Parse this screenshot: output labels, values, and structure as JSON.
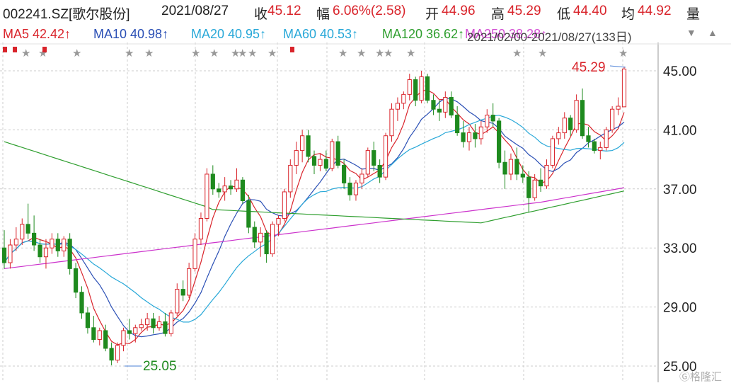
{
  "header": {
    "code": "002241.SZ[歌尔股份]",
    "date": "2021/08/27",
    "close_label": "收",
    "close_value": "45.12",
    "change_label": "幅",
    "change_value": "6.06%(2.58)",
    "open_label": "开",
    "open_value": "44.96",
    "high_label": "高",
    "high_value": "45.29",
    "low_label": "低",
    "low_value": "44.40",
    "avg_label": "均",
    "avg_value": "44.92",
    "volume_label": "量"
  },
  "ma_bar": {
    "ma5": "MA5  42.42↑",
    "ma10": "MA10  40.98↑",
    "ma20": "MA20  40.95↑",
    "ma60": "MA60  40.53↑",
    "ma120": "MA120  36.62↑",
    "ma250": "MA250  38.28↑",
    "range": "2021/02/00-2021/08/27(133日)",
    "dropdown": "▼"
  },
  "colors": {
    "up": "#d9242b",
    "down": "#1e8a1e",
    "ma5": "#d9242b",
    "ma10": "#2a4fb5",
    "ma20": "#28a8d8",
    "ma60": "#cc33cc",
    "ma120": "#2e9e2e",
    "ma250": "#cc33cc",
    "grid": "#cccccc"
  },
  "chart_data": {
    "type": "candlestick",
    "ylim": [
      25,
      46.2
    ],
    "yticks": [
      "45.00",
      "41.00",
      "37.00",
      "33.00",
      "29.00",
      "25.00"
    ],
    "ytick_values": [
      45,
      41,
      37,
      33,
      29,
      25
    ],
    "annotations": {
      "high": "45.29",
      "low": "25.05"
    },
    "grid": true,
    "candles": [
      [
        33.0,
        34.2,
        31.6,
        32.0
      ],
      [
        32.0,
        33.6,
        31.6,
        33.2
      ],
      [
        33.2,
        34.4,
        32.8,
        33.6
      ],
      [
        33.6,
        35.0,
        33.2,
        34.6
      ],
      [
        34.6,
        36.0,
        33.6,
        34.0
      ],
      [
        34.0,
        35.2,
        32.8,
        33.2
      ],
      [
        33.2,
        33.6,
        32.0,
        32.4
      ],
      [
        32.4,
        33.6,
        31.6,
        33.0
      ],
      [
        33.0,
        34.0,
        32.6,
        33.6
      ],
      [
        33.6,
        34.0,
        32.4,
        32.8
      ],
      [
        32.8,
        33.8,
        32.4,
        33.6
      ],
      [
        33.6,
        34.0,
        31.2,
        31.6
      ],
      [
        31.6,
        32.0,
        29.6,
        30.0
      ],
      [
        30.0,
        30.4,
        28.2,
        28.6
      ],
      [
        28.6,
        29.0,
        27.2,
        27.6
      ],
      [
        27.6,
        28.4,
        26.6,
        26.8
      ],
      [
        26.8,
        27.6,
        26.4,
        27.4
      ],
      [
        27.4,
        27.8,
        26.0,
        26.2
      ],
      [
        26.2,
        26.6,
        25.05,
        25.4
      ],
      [
        25.4,
        26.6,
        25.2,
        26.4
      ],
      [
        26.4,
        27.6,
        26.0,
        27.4
      ],
      [
        27.4,
        28.2,
        26.8,
        27.2
      ],
      [
        27.2,
        27.8,
        26.6,
        27.6
      ],
      [
        27.6,
        28.2,
        27.4,
        27.8
      ],
      [
        27.8,
        28.6,
        27.4,
        28.2
      ],
      [
        28.2,
        28.6,
        27.2,
        27.6
      ],
      [
        27.6,
        28.4,
        27.4,
        28.0
      ],
      [
        28.0,
        28.6,
        27.0,
        27.2
      ],
      [
        27.2,
        28.8,
        27.0,
        28.6
      ],
      [
        28.6,
        30.6,
        28.4,
        30.2
      ],
      [
        30.2,
        30.8,
        29.4,
        29.8
      ],
      [
        29.8,
        32.0,
        29.6,
        31.6
      ],
      [
        31.6,
        34.0,
        31.4,
        33.6
      ],
      [
        33.6,
        35.4,
        33.2,
        35.0
      ],
      [
        35.0,
        38.4,
        34.8,
        38.0
      ],
      [
        38.0,
        38.6,
        36.6,
        37.0
      ],
      [
        37.0,
        37.4,
        36.4,
        36.8
      ],
      [
        36.8,
        37.8,
        36.2,
        37.2
      ],
      [
        37.2,
        37.6,
        36.6,
        37.0
      ],
      [
        37.0,
        38.4,
        36.8,
        37.6
      ],
      [
        37.6,
        37.8,
        36.0,
        36.2
      ],
      [
        36.2,
        36.6,
        34.0,
        34.4
      ],
      [
        34.4,
        34.8,
        33.0,
        33.4
      ],
      [
        33.4,
        34.4,
        32.4,
        34.0
      ],
      [
        34.0,
        34.2,
        32.0,
        32.6
      ],
      [
        32.6,
        34.8,
        32.4,
        34.6
      ],
      [
        34.6,
        35.2,
        33.8,
        35.0
      ],
      [
        35.0,
        37.0,
        34.8,
        36.8
      ],
      [
        36.8,
        39.0,
        36.4,
        38.6
      ],
      [
        38.6,
        40.2,
        38.0,
        39.6
      ],
      [
        39.6,
        41.0,
        38.8,
        40.6
      ],
      [
        40.6,
        41.0,
        38.8,
        39.2
      ],
      [
        39.2,
        39.6,
        38.0,
        38.6
      ],
      [
        38.6,
        39.4,
        38.2,
        39.0
      ],
      [
        39.0,
        39.6,
        38.2,
        38.4
      ],
      [
        38.4,
        40.4,
        38.2,
        40.2
      ],
      [
        40.2,
        40.6,
        38.4,
        38.6
      ],
      [
        38.6,
        39.0,
        37.0,
        37.4
      ],
      [
        37.4,
        37.8,
        36.2,
        36.6
      ],
      [
        36.6,
        37.6,
        36.2,
        37.4
      ],
      [
        37.4,
        38.4,
        37.0,
        38.0
      ],
      [
        38.0,
        39.8,
        37.8,
        39.6
      ],
      [
        39.6,
        40.2,
        38.2,
        38.6
      ],
      [
        38.6,
        39.0,
        37.4,
        37.8
      ],
      [
        37.8,
        40.8,
        37.6,
        40.6
      ],
      [
        40.6,
        42.8,
        40.2,
        42.4
      ],
      [
        42.4,
        43.2,
        41.6,
        42.8
      ],
      [
        42.8,
        43.6,
        42.4,
        43.4
      ],
      [
        43.4,
        44.8,
        43.0,
        44.4
      ],
      [
        44.4,
        44.6,
        42.6,
        43.0
      ],
      [
        43.0,
        45.0,
        42.8,
        44.6
      ],
      [
        44.6,
        44.8,
        42.8,
        43.0
      ],
      [
        43.0,
        43.4,
        42.0,
        42.4
      ],
      [
        42.4,
        43.0,
        41.6,
        42.2
      ],
      [
        42.2,
        43.6,
        41.8,
        43.2
      ],
      [
        43.2,
        43.6,
        41.8,
        42.0
      ],
      [
        42.0,
        42.6,
        40.6,
        40.8
      ],
      [
        40.8,
        41.6,
        39.8,
        40.2
      ],
      [
        40.2,
        41.2,
        39.6,
        40.8
      ],
      [
        40.8,
        41.4,
        39.8,
        40.4
      ],
      [
        40.4,
        41.6,
        40.0,
        41.2
      ],
      [
        41.2,
        42.4,
        40.8,
        42.0
      ],
      [
        42.0,
        42.8,
        41.2,
        41.6
      ],
      [
        41.6,
        41.8,
        38.4,
        38.8
      ],
      [
        38.8,
        39.6,
        37.0,
        38.0
      ],
      [
        38.0,
        39.4,
        37.6,
        39.0
      ],
      [
        39.0,
        39.8,
        37.6,
        38.0
      ],
      [
        38.0,
        38.6,
        37.4,
        37.8
      ],
      [
        37.8,
        38.2,
        35.4,
        36.4
      ],
      [
        36.4,
        38.0,
        36.2,
        37.6
      ],
      [
        37.6,
        38.4,
        36.8,
        37.2
      ],
      [
        37.2,
        39.0,
        37.0,
        38.6
      ],
      [
        38.6,
        40.6,
        38.4,
        40.4
      ],
      [
        40.4,
        41.2,
        40.0,
        40.8
      ],
      [
        40.8,
        42.2,
        40.4,
        41.8
      ],
      [
        41.8,
        42.0,
        40.6,
        41.0
      ],
      [
        41.0,
        43.4,
        40.8,
        43.0
      ],
      [
        43.0,
        43.8,
        40.4,
        40.6
      ],
      [
        40.6,
        41.2,
        39.8,
        40.2
      ],
      [
        40.2,
        40.4,
        39.4,
        39.6
      ],
      [
        39.6,
        40.2,
        39.0,
        39.8
      ],
      [
        39.8,
        41.2,
        39.6,
        41.0
      ],
      [
        41.0,
        42.6,
        40.8,
        42.4
      ],
      [
        42.4,
        43.2,
        42.0,
        42.6
      ],
      [
        42.56,
        45.29,
        44.4,
        45.12
      ]
    ]
  }
}
